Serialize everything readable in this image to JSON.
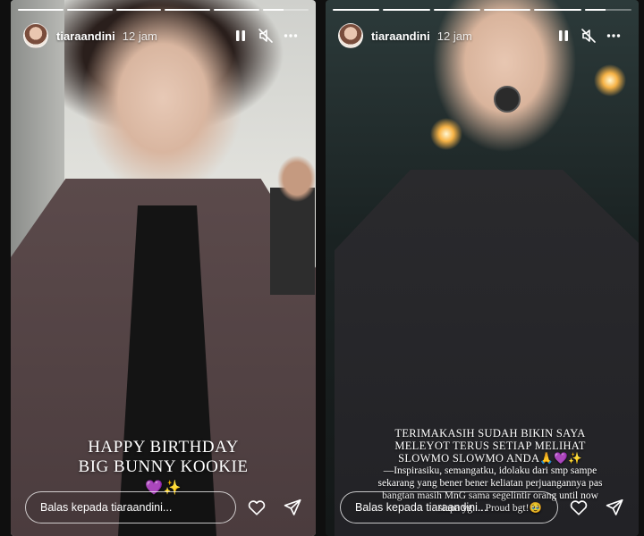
{
  "stories": [
    {
      "username": "tiaraandini",
      "time": "12 jam",
      "progress": [
        1,
        1,
        1,
        1,
        1,
        0.45
      ],
      "caption_lines": [
        "HAPPY BIRTHDAY",
        "BIG BUNNY KOOKIE"
      ],
      "caption_emoji": "💜✨",
      "reply_placeholder": "Balas kepada tiaraandini..."
    },
    {
      "username": "tiaraandini",
      "time": "12 jam",
      "progress": [
        1,
        1,
        1,
        1,
        1,
        0.45
      ],
      "caption_heading": "TERIMAKASIH SUDAH BIKIN SAYA MELEYOT TERUS SETIAP MELIHAT SLOWMO SLOWMO ANDA🙏💜✨",
      "caption_body": "—Inspirasiku, semangatku, idolaku dari smp sampe sekarang yang bener bener keliatan perjuangannya pas bangtan masih MnG sama segelintir orang until now siapa yg ... Proud bgt!🥹",
      "reply_placeholder": "Balas kepada tiaraandini..."
    }
  ],
  "icons": {
    "pause": "pause-icon",
    "mute": "muted-speaker-icon",
    "more": "more-icon",
    "like": "heart-icon",
    "share": "send-icon"
  },
  "colors": {
    "text": "#ffffff",
    "reply_border": "#ffffff",
    "app_bg": "#0f0f0f"
  }
}
